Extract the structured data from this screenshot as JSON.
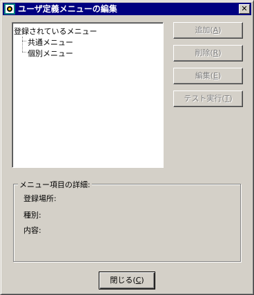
{
  "window": {
    "title": "ユーザ定義メニューの編集",
    "close_glyph": "✕"
  },
  "tree": {
    "root_label": "登録されているメニュー",
    "children": [
      "共通メニュー",
      "個別メニュー"
    ]
  },
  "buttons": {
    "add": {
      "label": "追加(",
      "mnemonic": "A",
      "suffix": ")"
    },
    "delete": {
      "label": "削除(",
      "mnemonic": "R",
      "suffix": ")"
    },
    "edit": {
      "label": "編集(",
      "mnemonic": "E",
      "suffix": ")"
    },
    "test": {
      "label": "テスト実行(",
      "mnemonic": "T",
      "suffix": ")"
    }
  },
  "details": {
    "group_title": "メニュー項目の詳細:",
    "location_label": "登録場所:",
    "type_label": "種別:",
    "content_label": "内容:"
  },
  "footer": {
    "close": {
      "label": "閉じる(",
      "mnemonic": "C",
      "suffix": ")"
    }
  },
  "colors": {
    "titlebar": "#000080",
    "face": "#d4d0c8"
  },
  "icons": {
    "app": "app-icon",
    "close": "close-icon"
  }
}
